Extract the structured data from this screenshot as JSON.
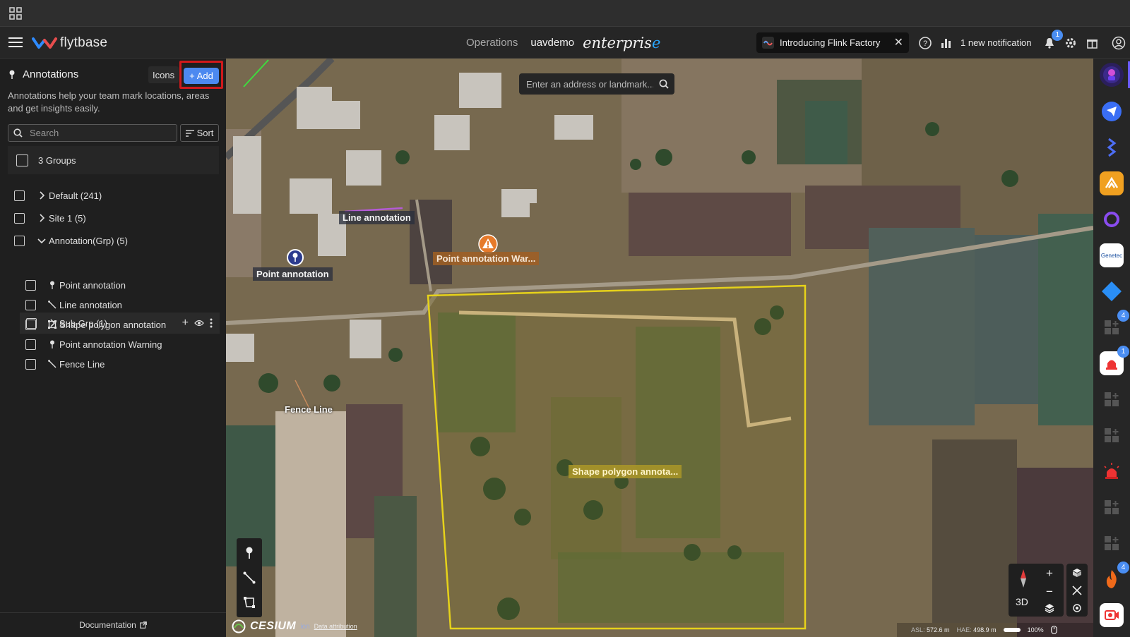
{
  "app": {
    "brand": "flytbase",
    "nav_operations": "Operations",
    "org_name": "uavdemo",
    "edition": "enterpris",
    "edition_accent": "e",
    "banner_text": "Introducing Flink Factory",
    "notification_text": "1 new notification",
    "notification_count": "1"
  },
  "sidebar": {
    "title": "Annotations",
    "icons_label": "Icons",
    "add_label": "Add",
    "description": "Annotations help your team mark locations, areas and get insights easily.",
    "search_placeholder": "Search",
    "sort_label": "Sort",
    "groups_label": "3 Groups",
    "tree": {
      "default": "Default (241)",
      "site1": "Site 1 (5)",
      "annotation_grp": "Annotation(Grp) (5)",
      "sub_grp": "Sub Grp (1)",
      "items": [
        {
          "label": "Point annotation",
          "icon": "pin-icon"
        },
        {
          "label": "Line annotation",
          "icon": "line-icon"
        },
        {
          "label": "Shape polygon annotation",
          "icon": "polygon-icon"
        },
        {
          "label": "Point annotation Warning",
          "icon": "pin-icon"
        },
        {
          "label": "Fence Line",
          "icon": "line-icon"
        }
      ]
    },
    "documentation": "Documentation"
  },
  "map": {
    "address_placeholder": "Enter an address or landmark...",
    "labels": {
      "line": "Line annotation",
      "point": "Point annotation",
      "warning": "Point annotation War...",
      "fence": "Fence Line",
      "polygon": "Shape polygon annota..."
    },
    "cesium": "CESIUM",
    "cesium_ion": "ion",
    "data_attribution": "Data attribution",
    "mode_3d": "3D",
    "asl_label": "ASL:",
    "asl_value": "572.6 m",
    "hae_label": "HAE:",
    "hae_value": "498.9 m",
    "zoom": "100%"
  },
  "rightbar": {
    "badges": {
      "grid1": "4",
      "alarm": "1",
      "fire": "4"
    }
  },
  "colors": {
    "accent": "#4c89f0",
    "polygon": "#e6d21a",
    "highlight": "#d0191b"
  }
}
